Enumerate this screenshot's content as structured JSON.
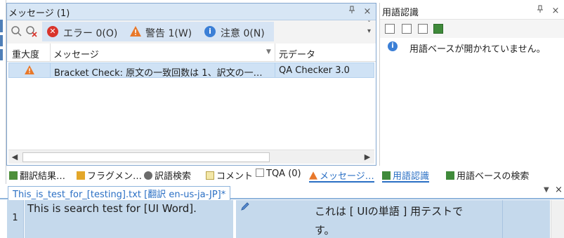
{
  "messages_panel": {
    "title": "メッセージ (1)",
    "pin": "ᵖ",
    "close": "×",
    "filters": {
      "error": "エラー 0(O)",
      "warning": "警告 1(W)",
      "info": "注意 0(N)"
    },
    "columns": {
      "severity": "重大度",
      "message": "メッセージ",
      "origin": "元データ"
    },
    "rows": [
      {
        "message": "Bracket Check: 原文の一致回数は 1、訳文の一…",
        "origin": "QA Checker 3.0"
      }
    ]
  },
  "bottom_tabs_left": [
    {
      "label": "翻訳結果…"
    },
    {
      "label": "フラグメン…"
    },
    {
      "label": "訳語検索"
    },
    {
      "label": "コメント"
    },
    {
      "label": "TQA (0)"
    },
    {
      "label": "メッセージ…"
    }
  ],
  "term_panel": {
    "title": "用語認識",
    "pin": "ᵖ",
    "close": "×",
    "message": "用語ベースが開かれていません。"
  },
  "bottom_tabs_right": [
    {
      "label": "用語認識"
    },
    {
      "label": "用語ベースの検索"
    }
  ],
  "editor": {
    "doc_tab": "This_is_test_for_[testing].txt [翻訳 en-us-ja-JP]*",
    "row_number": "1",
    "source": "This is search test for [UI Word].",
    "target": "これは [ UIの単語 ] 用テストです。"
  },
  "colors": {
    "accent": "#2a6fc4",
    "selection": "#cfe2f5",
    "error": "#d9342b",
    "warning": "#e8782a",
    "info": "#3b7fd6"
  }
}
